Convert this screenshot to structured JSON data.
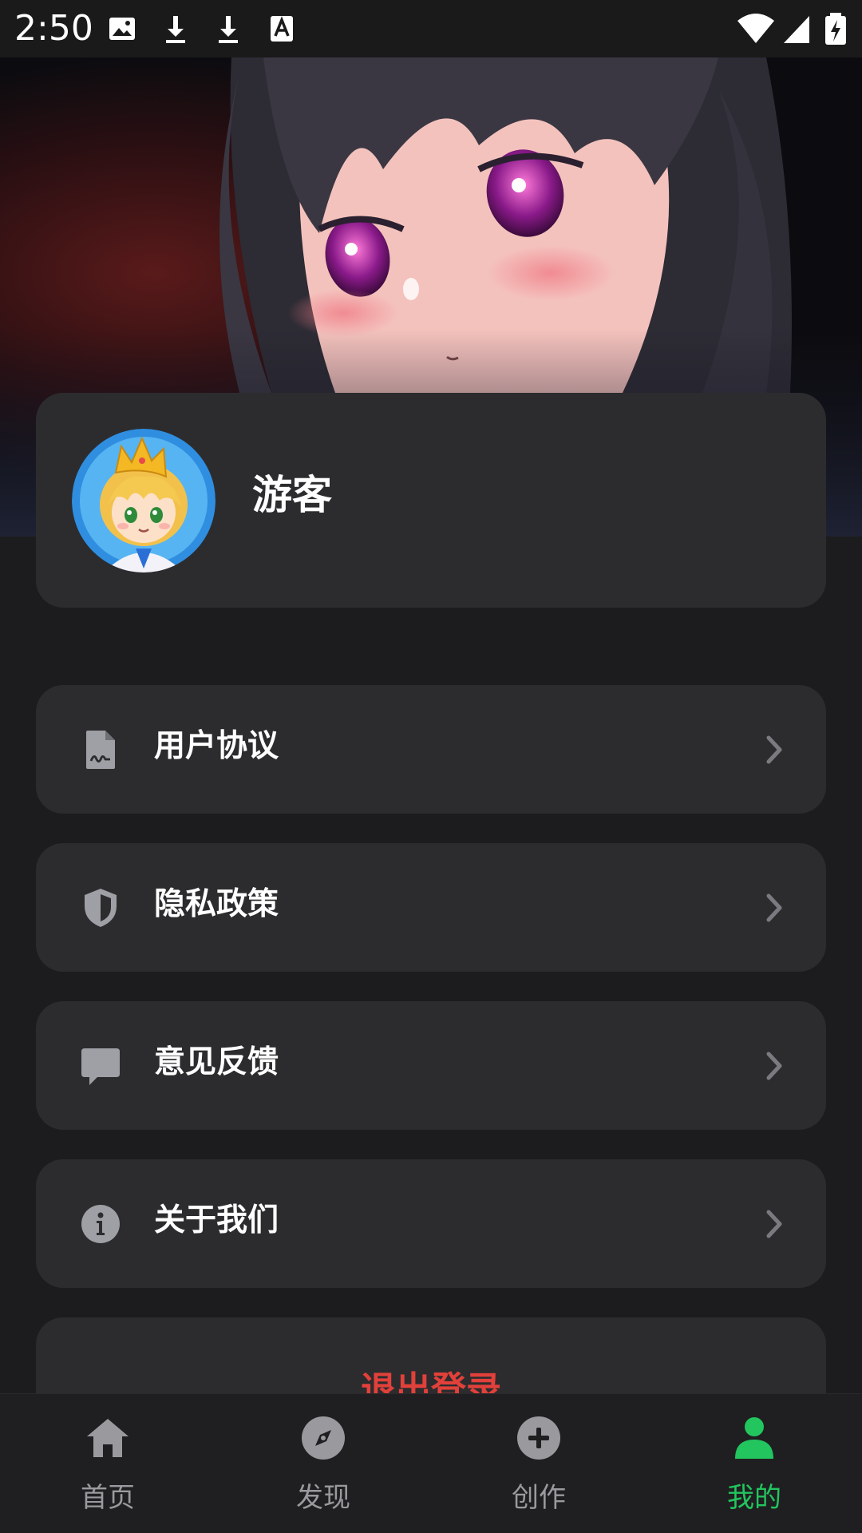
{
  "status_bar": {
    "time": "2:50",
    "left_icons": [
      "image-icon",
      "download-icon",
      "download-icon",
      "font-icon"
    ],
    "right_icons": [
      "wifi-icon",
      "signal-icon",
      "battery-charging-icon"
    ]
  },
  "profile": {
    "username": "游客"
  },
  "menu": {
    "items": [
      {
        "label": "用户协议",
        "icon": "document-signature-icon"
      },
      {
        "label": "隐私政策",
        "icon": "shield-icon"
      },
      {
        "label": "意见反馈",
        "icon": "chat-bubble-icon"
      },
      {
        "label": "关于我们",
        "icon": "info-icon"
      }
    ],
    "logout_label": "退出登录"
  },
  "bottom_nav": {
    "items": [
      {
        "label": "首页",
        "icon": "home-icon"
      },
      {
        "label": "发现",
        "icon": "compass-icon"
      },
      {
        "label": "创作",
        "icon": "add-circle-icon"
      },
      {
        "label": "我的",
        "icon": "user-icon",
        "active": true
      }
    ]
  },
  "colors": {
    "background": "#1c1c1e",
    "card": "#2c2c2e",
    "accent_active": "#22c55e",
    "nav_inactive": "#9a9a9e",
    "logout": "#e2403a",
    "icon_gray": "#9ea0a6",
    "chevron": "#7a7a80"
  }
}
